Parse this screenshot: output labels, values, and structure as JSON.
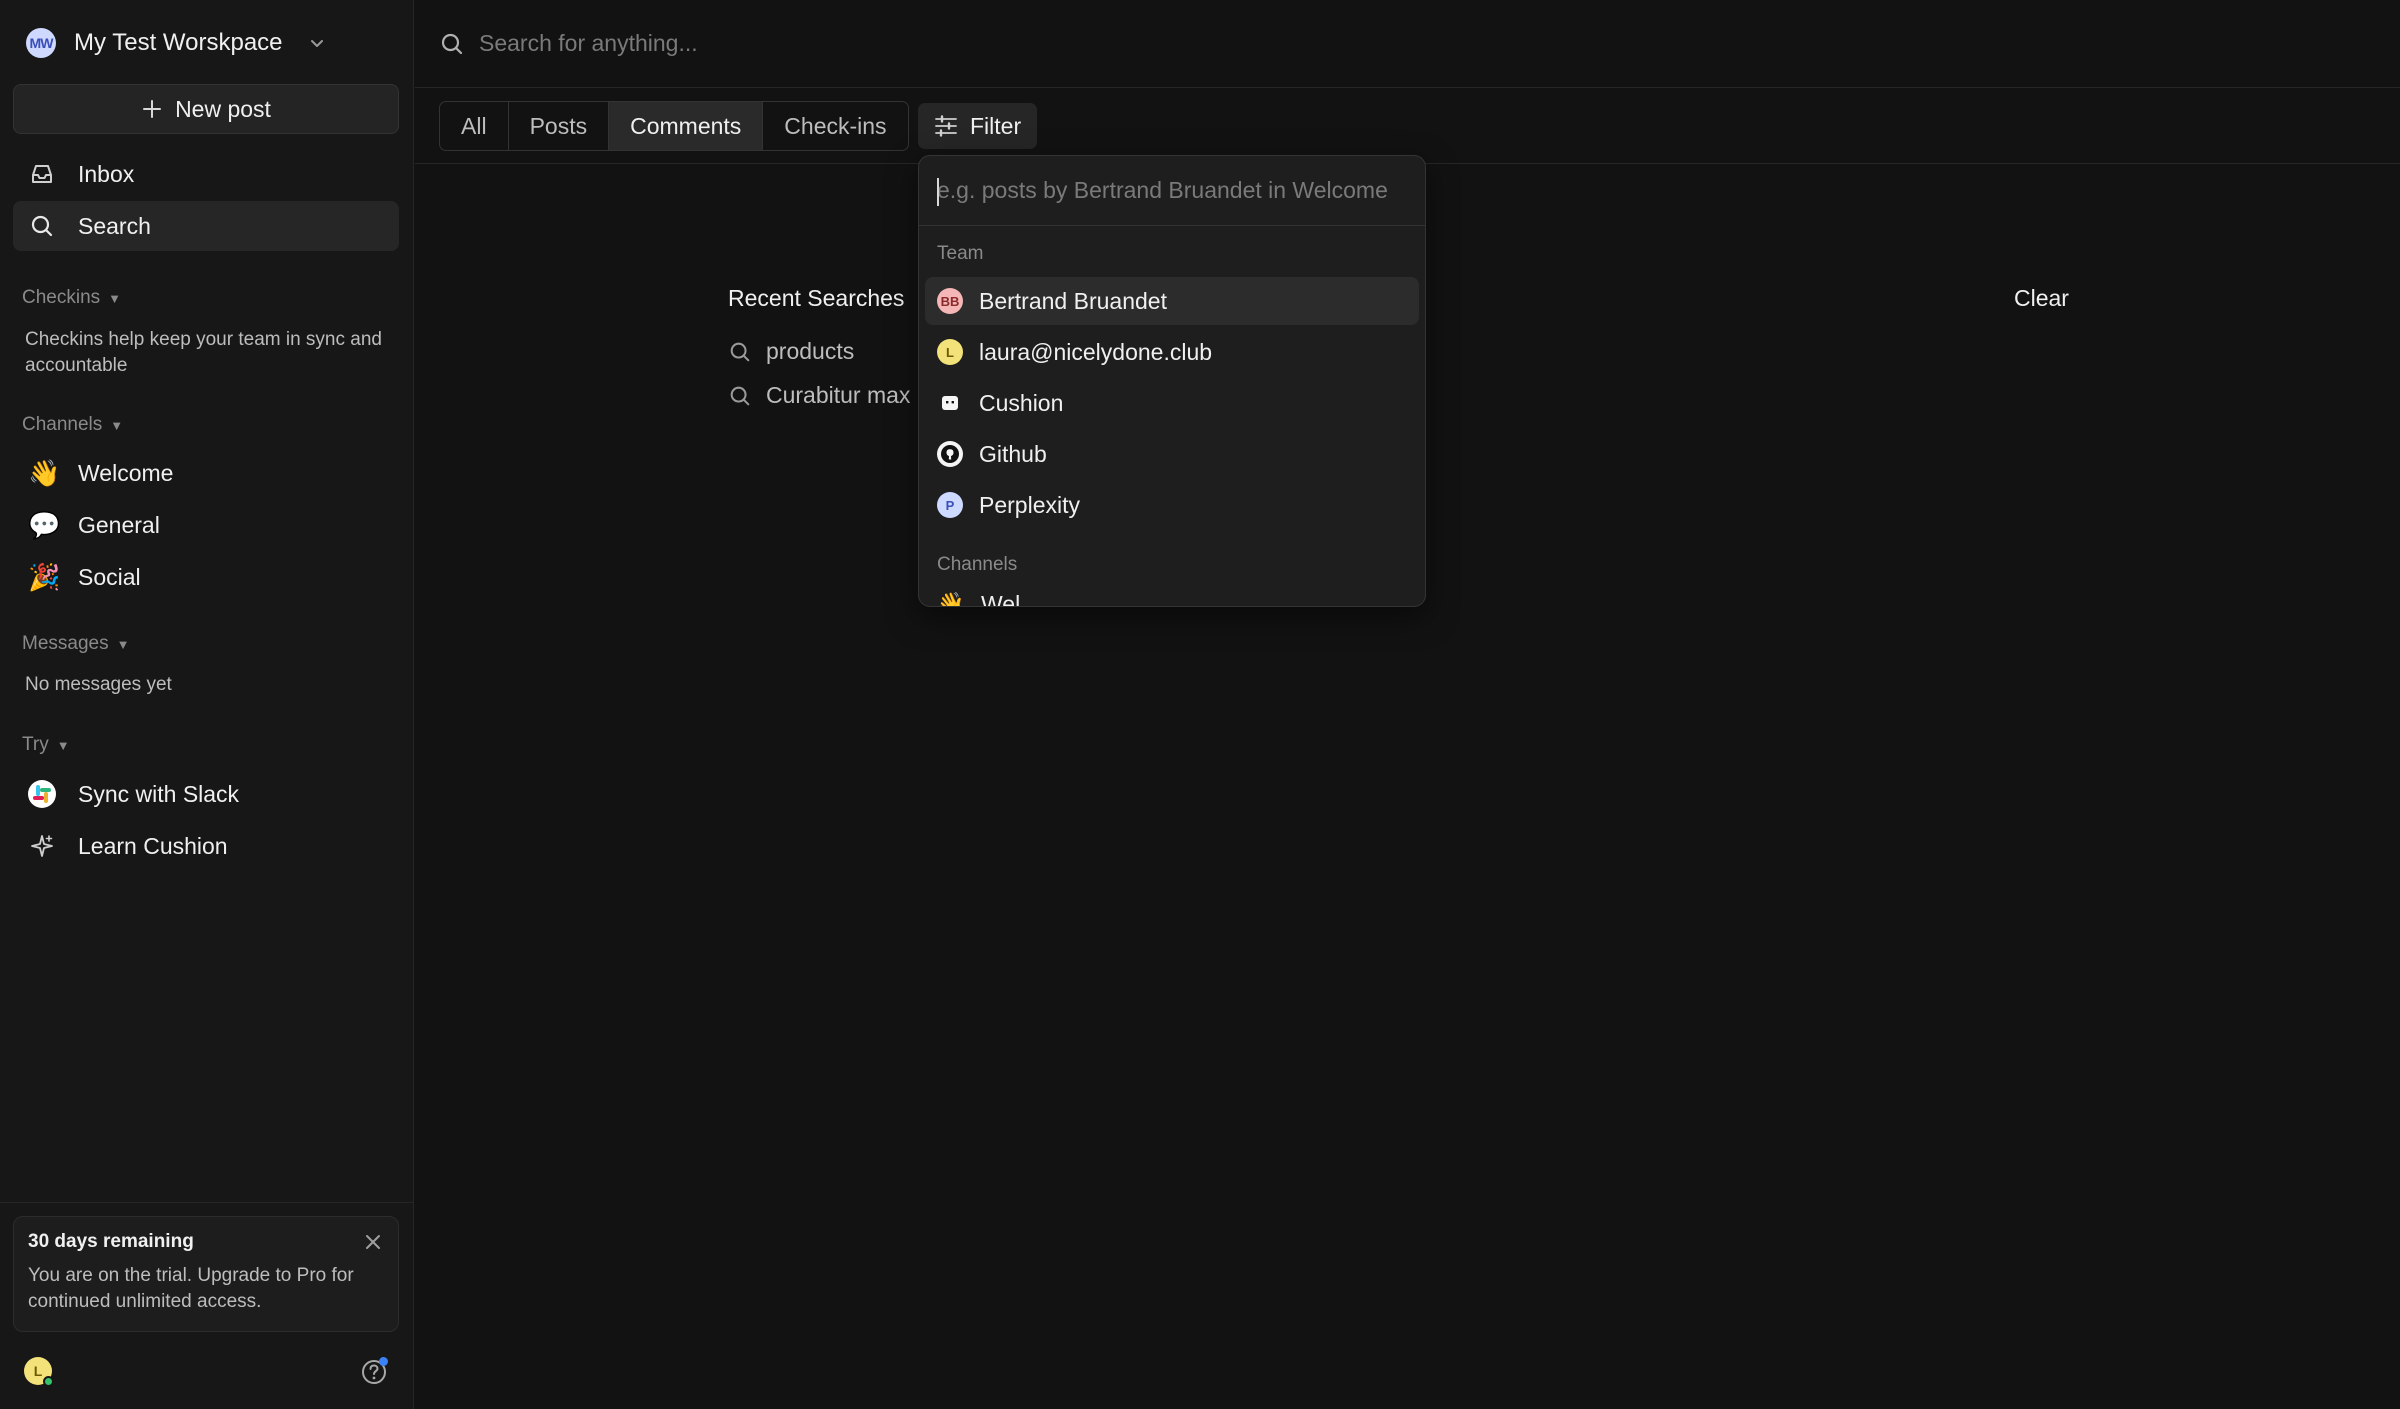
{
  "workspace": {
    "name": "My Test Worskpace",
    "initials": "MW"
  },
  "sidebar": {
    "new_post_label": "New post",
    "nav": [
      {
        "label": "Inbox"
      },
      {
        "label": "Search"
      }
    ],
    "checkins": {
      "title": "Checkins",
      "note": "Checkins help keep your team in sync and accountable"
    },
    "channels": {
      "title": "Channels",
      "items": [
        {
          "emoji": "👋",
          "label": "Welcome"
        },
        {
          "emoji": "💬",
          "label": "General"
        },
        {
          "emoji": "🎉",
          "label": "Social"
        }
      ]
    },
    "messages": {
      "title": "Messages",
      "note": "No messages yet"
    },
    "try": {
      "title": "Try",
      "items": [
        {
          "label": "Sync with Slack"
        },
        {
          "label": "Learn Cushion"
        }
      ]
    },
    "trial": {
      "title": "30 days remaining",
      "text": "You are on the trial. Upgrade to Pro for continued unlimited access."
    },
    "user_initial": "L"
  },
  "search": {
    "placeholder": "Search for anything..."
  },
  "tabs": [
    "All",
    "Posts",
    "Comments",
    "Check-ins"
  ],
  "active_tab": "Comments",
  "filter_label": "Filter",
  "recent": {
    "title": "Recent Searches",
    "clear_label": "Clear",
    "items": [
      "products",
      "Curabitur max"
    ]
  },
  "dropdown": {
    "placeholder": "e.g. posts by Bertrand Bruandet in Welcome",
    "team_title": "Team",
    "team": [
      {
        "initials": "BB",
        "name": "Bertrand Bruandet",
        "bg": "#f4b6b6",
        "fg": "#8a2a2a"
      },
      {
        "initials": "L",
        "name": "laura@nicelydone.club",
        "bg": "#f3e27a",
        "fg": "#6e5a00"
      },
      {
        "initials": "",
        "name": "Cushion",
        "bg": "#f5f5f5",
        "fg": "#111111"
      },
      {
        "initials": "",
        "name": "Github",
        "bg": "#f5f5f5",
        "fg": "#111111"
      },
      {
        "initials": "P",
        "name": "Perplexity",
        "bg": "#cdd9ff",
        "fg": "#3a4fb8"
      }
    ],
    "channels_title": "Channels",
    "channels_partial": "Wel"
  }
}
